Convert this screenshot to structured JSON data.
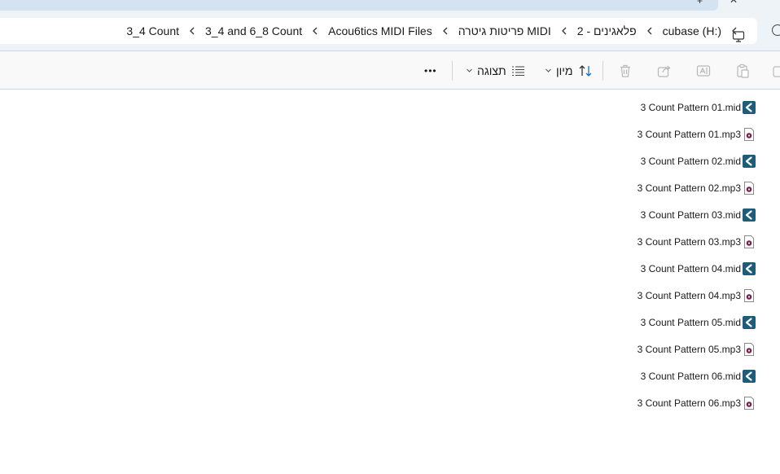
{
  "breadcrumb": {
    "items": [
      {
        "label": "cubase (H:)"
      },
      {
        "label": "2 - פלאגינים"
      },
      {
        "label": "פריטות גיטרה MIDI"
      },
      {
        "label": "Acou6tics MIDI Files"
      },
      {
        "label": "3_4 and 6_8 Count"
      },
      {
        "label": "3_4 Count"
      }
    ]
  },
  "toolbar": {
    "sort_label": "מיון",
    "view_label": "תצוגה",
    "more_label": "•••"
  },
  "icons": {
    "this_pc": "monitor-icon",
    "sort": "sort-arrows-icon",
    "view": "list-view-icon",
    "delete": "trash-icon",
    "share": "share-icon",
    "rename": "rename-icon",
    "paste": "clipboard-icon",
    "midi": "cubase-midi-file-icon",
    "mp3": "audio-file-icon"
  },
  "colors": {
    "accent": "#1f6fb5",
    "midi_icon_bg": "#1e5c7a",
    "mp3_icon_dot": "#7a1f4a"
  },
  "files": [
    {
      "name": "3 Count Pattern 01.mid",
      "type": "midi"
    },
    {
      "name": "3 Count Pattern 01.mp3",
      "type": "mp3"
    },
    {
      "name": "3 Count Pattern 02.mid",
      "type": "midi"
    },
    {
      "name": "3 Count Pattern 02.mp3",
      "type": "mp3"
    },
    {
      "name": "3 Count Pattern 03.mid",
      "type": "midi"
    },
    {
      "name": "3 Count Pattern 03.mp3",
      "type": "mp3"
    },
    {
      "name": "3 Count Pattern 04.mid",
      "type": "midi"
    },
    {
      "name": "3 Count Pattern 04.mp3",
      "type": "mp3"
    },
    {
      "name": "3 Count Pattern 05.mid",
      "type": "midi"
    },
    {
      "name": "3 Count Pattern 05.mp3",
      "type": "mp3"
    },
    {
      "name": "3 Count Pattern 06.mid",
      "type": "midi"
    },
    {
      "name": "3 Count Pattern 06.mp3",
      "type": "mp3"
    }
  ]
}
